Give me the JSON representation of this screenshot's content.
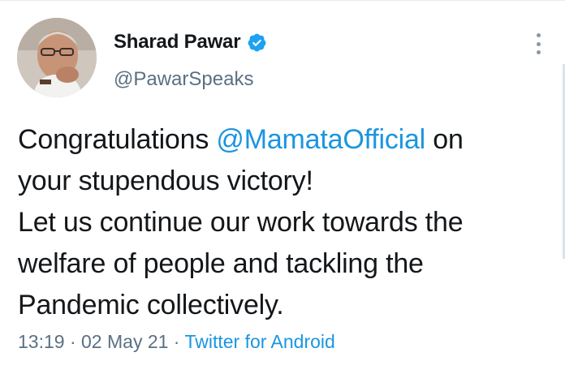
{
  "tweet": {
    "author": {
      "display_name": "Sharad Pawar",
      "handle": "@PawarSpeaks",
      "verified": true
    },
    "text": {
      "line1_prefix": "Congratulations ",
      "mention": "@MamataOfficial",
      "line1_suffix": " on",
      "line2": "your stupendous victory!",
      "line3": "Let us continue our work towards the",
      "line4": "welfare of people and tackling the",
      "line5": "Pandemic collectively."
    },
    "meta": {
      "time": "13:19",
      "separator1": " · ",
      "date": "02 May 21",
      "separator2": " · ",
      "source": "Twitter for Android"
    }
  },
  "icons": {
    "verified": "verified-badge-icon",
    "more": "more-options-icon"
  },
  "colors": {
    "text": "#14171a",
    "secondary": "#5b7083",
    "link": "#1b95e0",
    "verified": "#1da1f2"
  }
}
